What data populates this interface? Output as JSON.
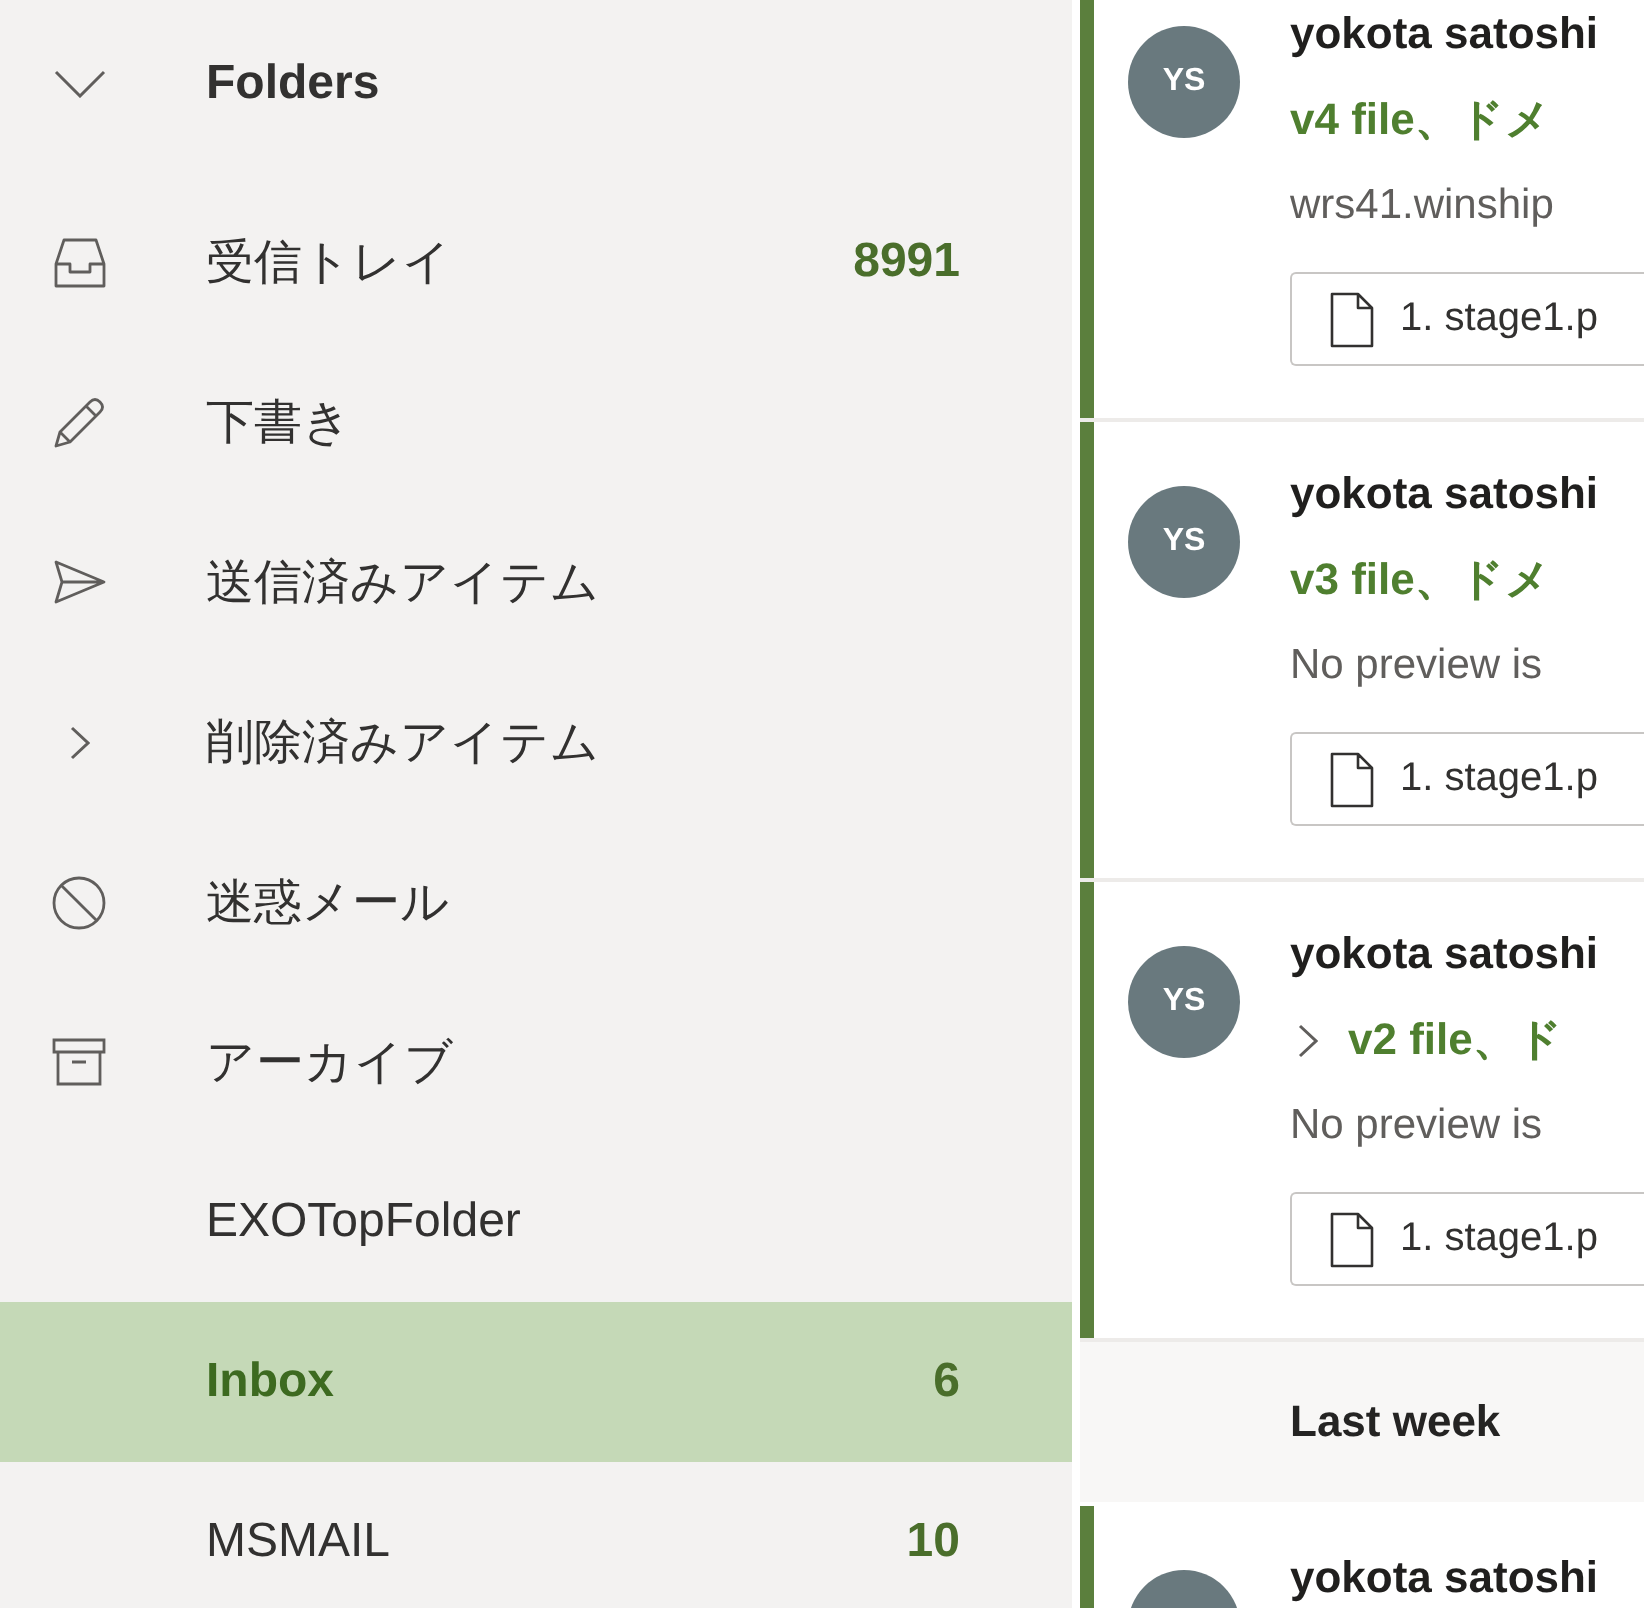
{
  "folder_pane": {
    "header": {
      "label": "Folders",
      "expanded": true
    },
    "folders": [
      {
        "name": "受信トレイ",
        "count": "8991",
        "selected": false
      },
      {
        "name": "下書き",
        "selected": false
      },
      {
        "name": "送信済みアイテム",
        "selected": false
      },
      {
        "name": "削除済みアイテム",
        "expanded": false,
        "selected": false
      },
      {
        "name": "迷惑メール",
        "selected": false
      },
      {
        "name": "アーカイブ",
        "selected": false
      },
      {
        "name": "EXOTopFolder",
        "selected": false
      },
      {
        "name": "Inbox",
        "count": "6",
        "selected": true
      },
      {
        "name": "MSMAIL",
        "count": "10",
        "selected": false
      }
    ]
  },
  "message_list": {
    "items": [
      {
        "kind": "message",
        "unread": true,
        "initials": "YS",
        "sender": "yokota satoshi",
        "subject": "v4 file、ドメ",
        "preview": "wrs41.winship",
        "attachment": "1. stage1.p"
      },
      {
        "kind": "message",
        "unread": true,
        "initials": "YS",
        "sender": "yokota satoshi",
        "subject": "v3 file、ドメ",
        "preview": "No preview is",
        "attachment": "1. stage1.p"
      },
      {
        "kind": "thread",
        "expanded": false,
        "unread": true,
        "initials": "YS",
        "sender": "yokota satoshi",
        "subject": "v2 file、ド",
        "preview": "No preview is",
        "attachment": "1. stage1.p"
      },
      {
        "kind": "group_header",
        "label": "Last week"
      },
      {
        "kind": "message",
        "unread": true,
        "sender": "yokota satoshi"
      }
    ]
  }
}
